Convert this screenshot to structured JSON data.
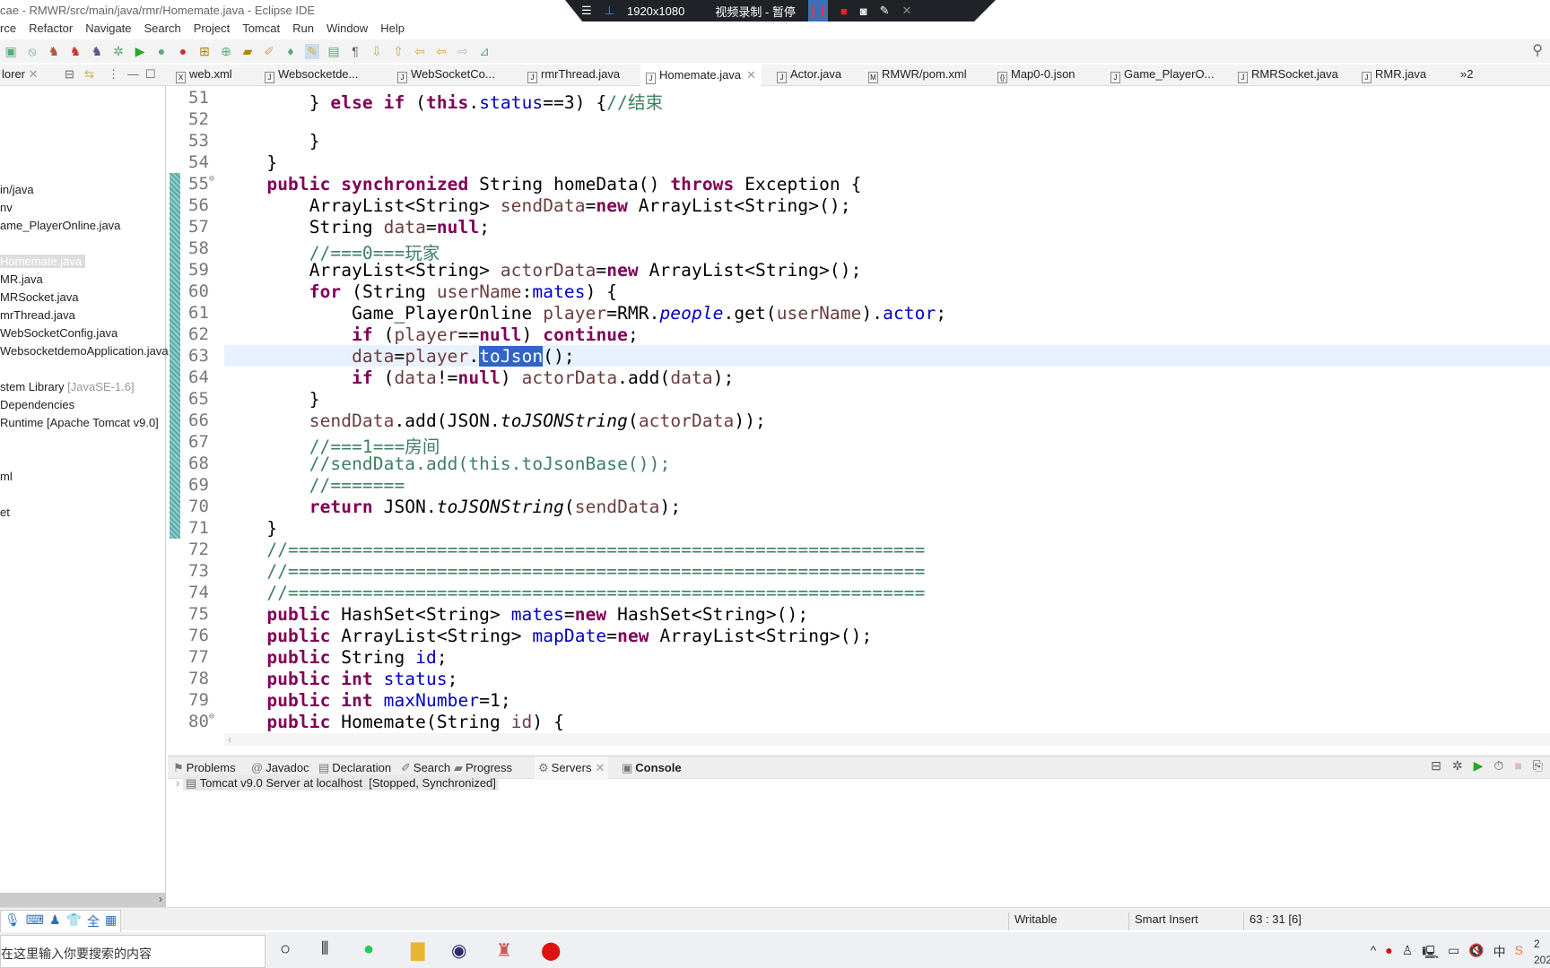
{
  "window": {
    "title": "cae - RMWR/src/main/java/rmr/Homemate.java - Eclipse IDE"
  },
  "recorder": {
    "resolution": "1920x1080",
    "status": "视频录制 - 暂停"
  },
  "menu": [
    "rce",
    "Refactor",
    "Navigate",
    "Search",
    "Project",
    "Tomcat",
    "Run",
    "Window",
    "Help"
  ],
  "explorer": {
    "tab_label": "lorer",
    "items": [
      {
        "text": "in/java",
        "extra": ""
      },
      {
        "text": "nv",
        "extra": ""
      },
      {
        "text": "ame_PlayerOnline.java",
        "extra": ""
      },
      {
        "text": "Homemate.java",
        "extra": "",
        "selected": true
      },
      {
        "text": "MR.java",
        "extra": ""
      },
      {
        "text": "MRSocket.java",
        "extra": ""
      },
      {
        "text": "mrThread.java",
        "extra": ""
      },
      {
        "text": "WebSocketConfig.java",
        "extra": ""
      },
      {
        "text": "WebsocketdemoApplication.java",
        "extra": ""
      },
      {
        "text": "stem Library ",
        "extra": "[JavaSE-1.6]"
      },
      {
        "text": " Dependencies",
        "extra": ""
      },
      {
        "text": " Runtime [Apache Tomcat v9.0]",
        "extra": ""
      },
      {
        "text": "ml",
        "extra": ""
      },
      {
        "text": "et",
        "extra": ""
      }
    ]
  },
  "editor_tabs": [
    {
      "label": "web.xml",
      "icon": "xml-file-icon"
    },
    {
      "label": "Websocketde...",
      "icon": "java-file-icon"
    },
    {
      "label": "WebSocketCo...",
      "icon": "java-file-icon"
    },
    {
      "label": "rmrThread.java",
      "icon": "java-file-icon"
    },
    {
      "label": "Homemate.java",
      "icon": "java-file-icon",
      "active": true
    },
    {
      "label": "Actor.java",
      "icon": "java-file-icon"
    },
    {
      "label": "RMWR/pom.xml",
      "icon": "maven-file-icon"
    },
    {
      "label": "Map0-0.json",
      "icon": "json-file-icon"
    },
    {
      "label": "Game_PlayerO...",
      "icon": "java-file-icon"
    },
    {
      "label": "RMRSocket.java",
      "icon": "java-file-icon"
    },
    {
      "label": "RMR.java",
      "icon": "java-file-icon"
    },
    {
      "label": "»2",
      "icon": "overflow-icon"
    }
  ],
  "code": {
    "current_line": 63,
    "lines": [
      {
        "n": "51",
        "t": [
          [
            "",
            "        } "
          ],
          [
            "kw",
            "else if"
          ],
          [
            "",
            " ("
          ],
          [
            "kw",
            "this"
          ],
          [
            "",
            "."
          ],
          [
            "fld",
            "status"
          ],
          [
            "",
            "==3) {"
          ],
          [
            "cm",
            "//结束"
          ]
        ]
      },
      {
        "n": "52",
        "t": []
      },
      {
        "n": "53",
        "t": [
          [
            "",
            "        }"
          ]
        ]
      },
      {
        "n": "54",
        "t": [
          [
            "",
            "    }"
          ]
        ]
      },
      {
        "n": "55",
        "t": [
          [
            "",
            "    "
          ],
          [
            "kw",
            "public synchronized"
          ],
          [
            "",
            " String homeData() "
          ],
          [
            "kw",
            "throws"
          ],
          [
            "",
            " Exception {"
          ]
        ]
      },
      {
        "n": "56",
        "t": [
          [
            "",
            "        ArrayList<String> "
          ],
          [
            "var",
            "sendData"
          ],
          [
            "",
            "="
          ],
          [
            "kw",
            "new"
          ],
          [
            "",
            " ArrayList<String>();"
          ]
        ]
      },
      {
        "n": "57",
        "t": [
          [
            "",
            "        String "
          ],
          [
            "var",
            "data"
          ],
          [
            "",
            "="
          ],
          [
            "kw",
            "null"
          ],
          [
            "",
            ";"
          ]
        ]
      },
      {
        "n": "58",
        "t": [
          [
            "cm",
            "        //===0===玩家"
          ]
        ]
      },
      {
        "n": "59",
        "t": [
          [
            "",
            "        ArrayList<String> "
          ],
          [
            "var",
            "actorData"
          ],
          [
            "",
            "="
          ],
          [
            "kw",
            "new"
          ],
          [
            "",
            " ArrayList<String>();"
          ]
        ]
      },
      {
        "n": "60",
        "t": [
          [
            "",
            "        "
          ],
          [
            "kw",
            "for"
          ],
          [
            "",
            " (String "
          ],
          [
            "var",
            "userName"
          ],
          [
            "",
            ":"
          ],
          [
            "fld",
            "mates"
          ],
          [
            "",
            ") {"
          ]
        ]
      },
      {
        "n": "61",
        "t": [
          [
            "",
            "            Game_PlayerOnline "
          ],
          [
            "var",
            "player"
          ],
          [
            "",
            "=RMR."
          ],
          [
            "itf",
            "people"
          ],
          [
            "",
            ".get("
          ],
          [
            "var",
            "userName"
          ],
          [
            "",
            ")."
          ],
          [
            "fld",
            "actor"
          ],
          [
            "",
            ";"
          ]
        ]
      },
      {
        "n": "62",
        "t": [
          [
            "",
            "            "
          ],
          [
            "kw",
            "if"
          ],
          [
            "",
            " ("
          ],
          [
            "var",
            "player"
          ],
          [
            "",
            "=="
          ],
          [
            "kw",
            "null"
          ],
          [
            "",
            ") "
          ],
          [
            "kw",
            "continue"
          ],
          [
            "",
            ";"
          ]
        ]
      },
      {
        "n": "63",
        "t": [
          [
            "",
            "            "
          ],
          [
            "var",
            "data"
          ],
          [
            "",
            "="
          ],
          [
            "var",
            "player"
          ],
          [
            "",
            "."
          ],
          [
            "sel",
            "toJson"
          ],
          [
            "",
            "();"
          ]
        ]
      },
      {
        "n": "64",
        "t": [
          [
            "",
            "            "
          ],
          [
            "kw",
            "if"
          ],
          [
            "",
            " ("
          ],
          [
            "var",
            "data"
          ],
          [
            "",
            "!="
          ],
          [
            "kw",
            "null"
          ],
          [
            "",
            ") "
          ],
          [
            "var",
            "actorData"
          ],
          [
            "",
            ".add("
          ],
          [
            "var",
            "data"
          ],
          [
            "",
            ");"
          ]
        ]
      },
      {
        "n": "65",
        "t": [
          [
            "",
            "        }"
          ]
        ]
      },
      {
        "n": "66",
        "t": [
          [
            "",
            "        "
          ],
          [
            "var",
            "sendData"
          ],
          [
            "",
            ".add(JSON."
          ],
          [
            "it",
            "toJSONString"
          ],
          [
            "",
            "("
          ],
          [
            "var",
            "actorData"
          ],
          [
            "",
            "));"
          ]
        ]
      },
      {
        "n": "67",
        "t": [
          [
            "cm",
            "        //===1===房间"
          ]
        ]
      },
      {
        "n": "68",
        "t": [
          [
            "cm",
            "        //sendData.add(this.toJsonBase());"
          ]
        ]
      },
      {
        "n": "69",
        "t": [
          [
            "cm",
            "        //======="
          ]
        ]
      },
      {
        "n": "70",
        "t": [
          [
            "",
            "        "
          ],
          [
            "kw",
            "return"
          ],
          [
            "",
            " JSON."
          ],
          [
            "it",
            "toJSONString"
          ],
          [
            "",
            "("
          ],
          [
            "var",
            "sendData"
          ],
          [
            "",
            ");"
          ]
        ]
      },
      {
        "n": "71",
        "t": [
          [
            "",
            "    }"
          ]
        ]
      },
      {
        "n": "72",
        "t": [
          [
            "cm",
            "    //============================================================"
          ]
        ]
      },
      {
        "n": "73",
        "t": [
          [
            "cm",
            "    //============================================================"
          ]
        ]
      },
      {
        "n": "74",
        "t": [
          [
            "cm",
            "    //============================================================"
          ]
        ]
      },
      {
        "n": "75",
        "t": [
          [
            "",
            "    "
          ],
          [
            "kw",
            "public"
          ],
          [
            "",
            " HashSet<String> "
          ],
          [
            "fld",
            "mates"
          ],
          [
            "",
            "="
          ],
          [
            "kw",
            "new"
          ],
          [
            "",
            " HashSet<String>();"
          ]
        ]
      },
      {
        "n": "76",
        "t": [
          [
            "",
            "    "
          ],
          [
            "kw",
            "public"
          ],
          [
            "",
            " ArrayList<String> "
          ],
          [
            "fld",
            "mapDate"
          ],
          [
            "",
            "="
          ],
          [
            "kw",
            "new"
          ],
          [
            "",
            " ArrayList<String>();"
          ]
        ]
      },
      {
        "n": "77",
        "t": [
          [
            "",
            "    "
          ],
          [
            "kw",
            "public"
          ],
          [
            "",
            " String "
          ],
          [
            "fld",
            "id"
          ],
          [
            "",
            ";"
          ]
        ]
      },
      {
        "n": "78",
        "t": [
          [
            "",
            "    "
          ],
          [
            "kw",
            "public int"
          ],
          [
            "",
            " "
          ],
          [
            "fld",
            "status"
          ],
          [
            "",
            ";"
          ]
        ]
      },
      {
        "n": "79",
        "t": [
          [
            "",
            "    "
          ],
          [
            "kw",
            "public int"
          ],
          [
            "",
            " "
          ],
          [
            "fld",
            "maxNumber"
          ],
          [
            "",
            "=1;"
          ]
        ]
      },
      {
        "n": "80",
        "t": [
          [
            "",
            "    "
          ],
          [
            "kw",
            "public"
          ],
          [
            "",
            " Homemate(String "
          ],
          [
            "var",
            "id"
          ],
          [
            "",
            ") {"
          ]
        ]
      }
    ]
  },
  "panel": {
    "tabs": [
      "Problems",
      "Javadoc",
      "Declaration",
      "Search",
      "Progress",
      "Servers",
      "Console"
    ],
    "active_tab": "Servers",
    "server_row": {
      "name": "Tomcat v9.0 Server at localhost",
      "state": "[Stopped, Synchronized]"
    }
  },
  "status": {
    "mode": "Writable",
    "insert": "Smart Insert",
    "position": "63 : 31 [6]"
  },
  "taskbar": {
    "search_placeholder": "在这里输入你要搜索的内容",
    "clock_time": "2",
    "clock_date": "202"
  }
}
